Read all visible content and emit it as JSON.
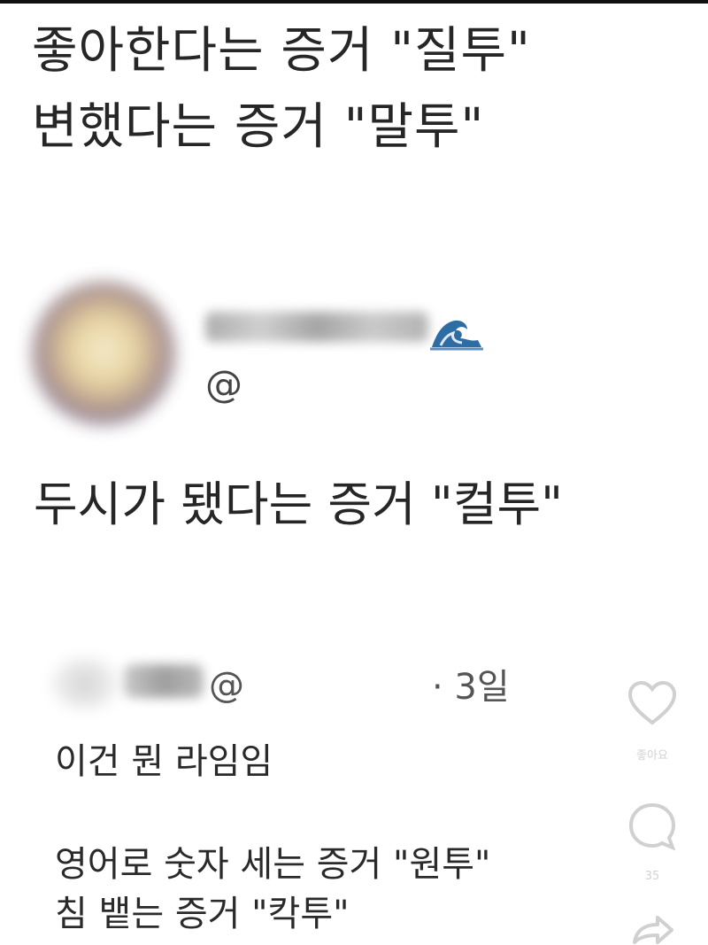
{
  "headline": {
    "line1": "좋아한다는 증거 \"질투\"",
    "line2": "변했다는 증거 \"말투\""
  },
  "tweet": {
    "handle_prefix": "@",
    "body": "두시가 됐다는 증거 \"컬투\"",
    "emoji_icon": "wave-icon"
  },
  "reply": {
    "handle_prefix": "@",
    "time": "· 3일",
    "line1": "이건 뭔 라임임",
    "line2": "영어로 숫자 세는 증거 \"원투\"",
    "line3": "침 뱉는 증거 \"칵투\""
  },
  "actions": {
    "like_icon": "heart-icon",
    "like_label": "좋아요",
    "comment_icon": "comment-icon",
    "comment_count": "35",
    "share_icon": "share-icon"
  },
  "colors": {
    "text": "#262626",
    "muted": "#555555",
    "overlay_icon": "#cfcfcf"
  }
}
